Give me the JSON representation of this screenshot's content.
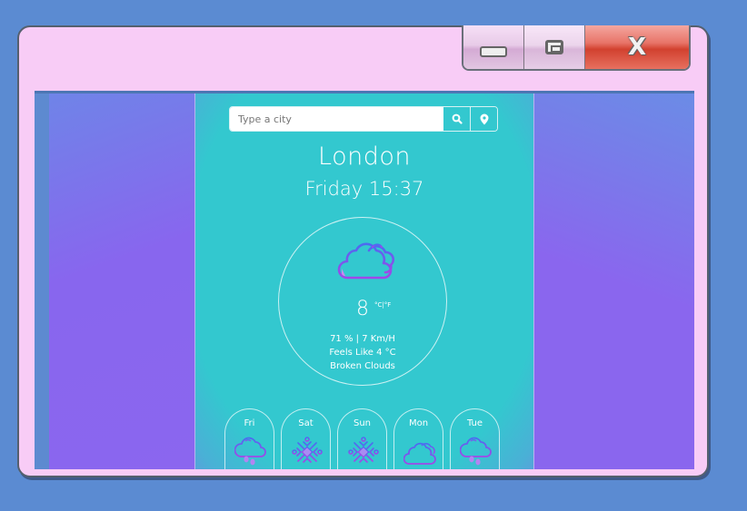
{
  "window": {
    "controls": {
      "minimize": "minimize",
      "maximize": "maximize",
      "close": "close"
    }
  },
  "search": {
    "placeholder": "Type a city",
    "value": "",
    "search_icon": "search-icon",
    "location_icon": "map-marker-icon"
  },
  "weather": {
    "city": "London",
    "datetime": "Friday 15:37",
    "icon": "broken-clouds-icon",
    "temperature": "8",
    "unit_c": "°C",
    "unit_sep": "|",
    "unit_f": "°F",
    "humidity_wind": "71 % | 7 Km/H",
    "feels_like": "Feels Like 4 °C",
    "description": "Broken Clouds"
  },
  "forecast": [
    {
      "day": "Fri",
      "icon": "rain-clouds-icon"
    },
    {
      "day": "Sat",
      "icon": "snowflake-icon"
    },
    {
      "day": "Sun",
      "icon": "snowflake-icon"
    },
    {
      "day": "Mon",
      "icon": "broken-clouds-icon"
    },
    {
      "day": "Tue",
      "icon": "rain-clouds-icon"
    }
  ],
  "colors": {
    "desktop": "#5b8bd2",
    "window_frame": "#f8ccf6",
    "app_teal": "#33c8cf",
    "side_purple": "#8b66ef",
    "icon_gradient_start": "#4b6cf0",
    "icon_gradient_end": "#a247e8",
    "close_red": "#d2412f"
  }
}
